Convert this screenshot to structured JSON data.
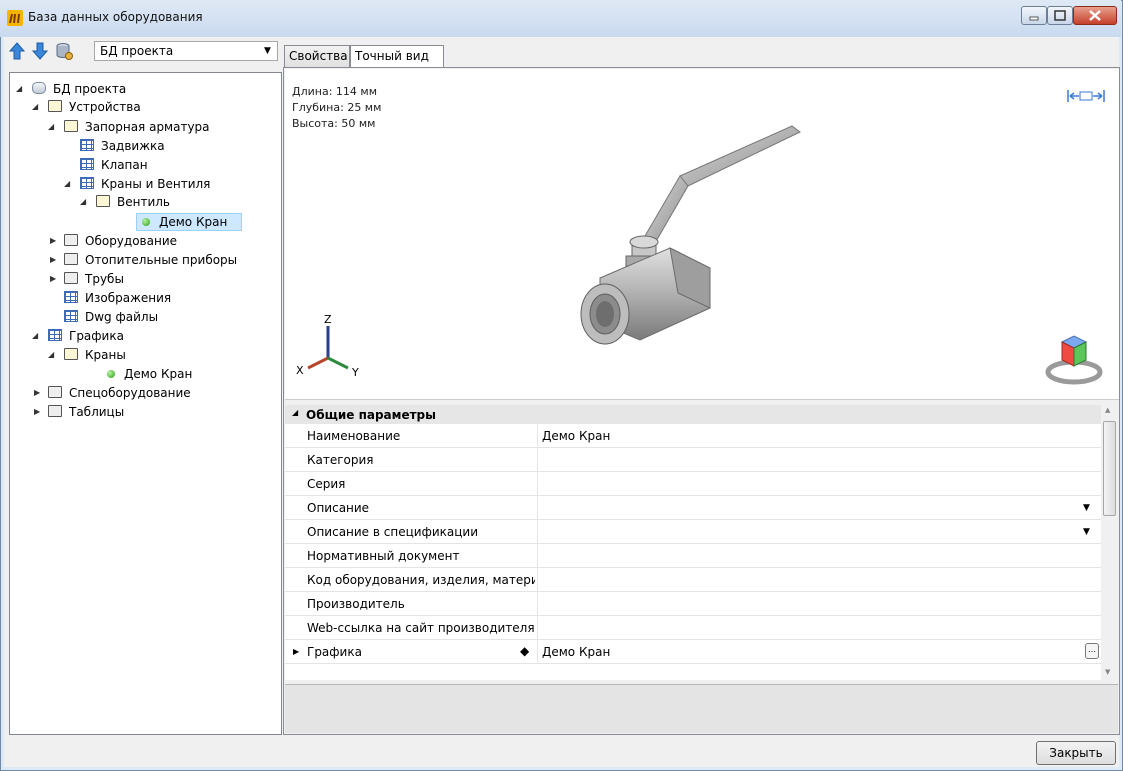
{
  "window": {
    "title": "База данных оборудования"
  },
  "toolbar": {
    "db_select_value": "БД проекта"
  },
  "tree": {
    "items": [
      {
        "label": "БД проекта"
      },
      {
        "label": "Устройства"
      },
      {
        "label": "Запорная арматура"
      },
      {
        "label": "Задвижка"
      },
      {
        "label": "Клапан"
      },
      {
        "label": "Краны и Вентиля"
      },
      {
        "label": "Вентиль"
      },
      {
        "label": "Демо Кран"
      },
      {
        "label": "Оборудование"
      },
      {
        "label": "Отопительные приборы"
      },
      {
        "label": "Трубы"
      },
      {
        "label": "Изображения"
      },
      {
        "label": "Dwg файлы"
      },
      {
        "label": "Графика"
      },
      {
        "label": "Краны"
      },
      {
        "label": "Демо Кран"
      },
      {
        "label": "Спецоборудование"
      },
      {
        "label": "Таблицы"
      }
    ]
  },
  "tabs": {
    "properties": "Свойства",
    "exact_view": "Точный вид"
  },
  "viewport": {
    "length": "Длина: 114 мм",
    "depth": "Глубина: 25 мм",
    "height": "Высота: 50 мм",
    "axis_z": "Z",
    "axis_x": "X",
    "axis_y": "Y"
  },
  "propgrid": {
    "section": "Общие параметры",
    "rows": [
      {
        "name": "Наименование",
        "value": "Демо Кран"
      },
      {
        "name": "Категория",
        "value": ""
      },
      {
        "name": "Серия",
        "value": ""
      },
      {
        "name": "Описание",
        "value": ""
      },
      {
        "name": "Описание в спецификации",
        "value": ""
      },
      {
        "name": "Нормативный документ",
        "value": ""
      },
      {
        "name": "Код оборудования, изделия, матери...",
        "value": ""
      },
      {
        "name": "Производитель",
        "value": ""
      },
      {
        "name": "Web-ссылка на сайт производителя",
        "value": ""
      },
      {
        "name": "Графика",
        "value": "Демо Кран"
      }
    ]
  },
  "footer": {
    "close_label": "Закрыть"
  }
}
